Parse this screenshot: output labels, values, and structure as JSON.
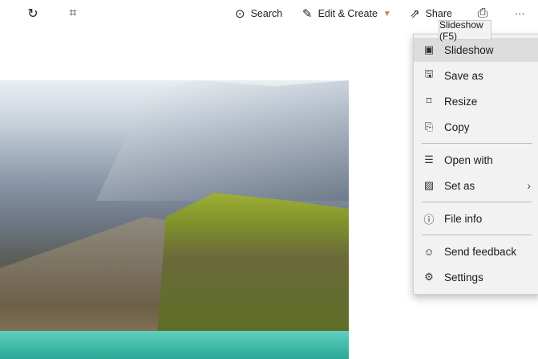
{
  "toolbar": {
    "rotate_icon": "rotate-icon",
    "crop_icon": "crop-icon",
    "search_label": "Search",
    "edit_create_label": "Edit & Create",
    "share_label": "Share",
    "more_label": "···"
  },
  "tooltip": "Slideshow (F5)",
  "menu": {
    "items": [
      {
        "label": "Slideshow",
        "icon": "▣"
      },
      {
        "label": "Save as",
        "icon": "🖫"
      },
      {
        "label": "Resize",
        "icon": "⌑"
      },
      {
        "label": "Copy",
        "icon": "⎘"
      },
      {
        "label": "Open with",
        "icon": "☰"
      },
      {
        "label": "Set as",
        "icon": "▨",
        "submenu": "›"
      },
      {
        "label": "File info",
        "icon": "ⓘ"
      },
      {
        "label": "Send feedback",
        "icon": "☺"
      },
      {
        "label": "Settings",
        "icon": "⚙"
      }
    ]
  }
}
